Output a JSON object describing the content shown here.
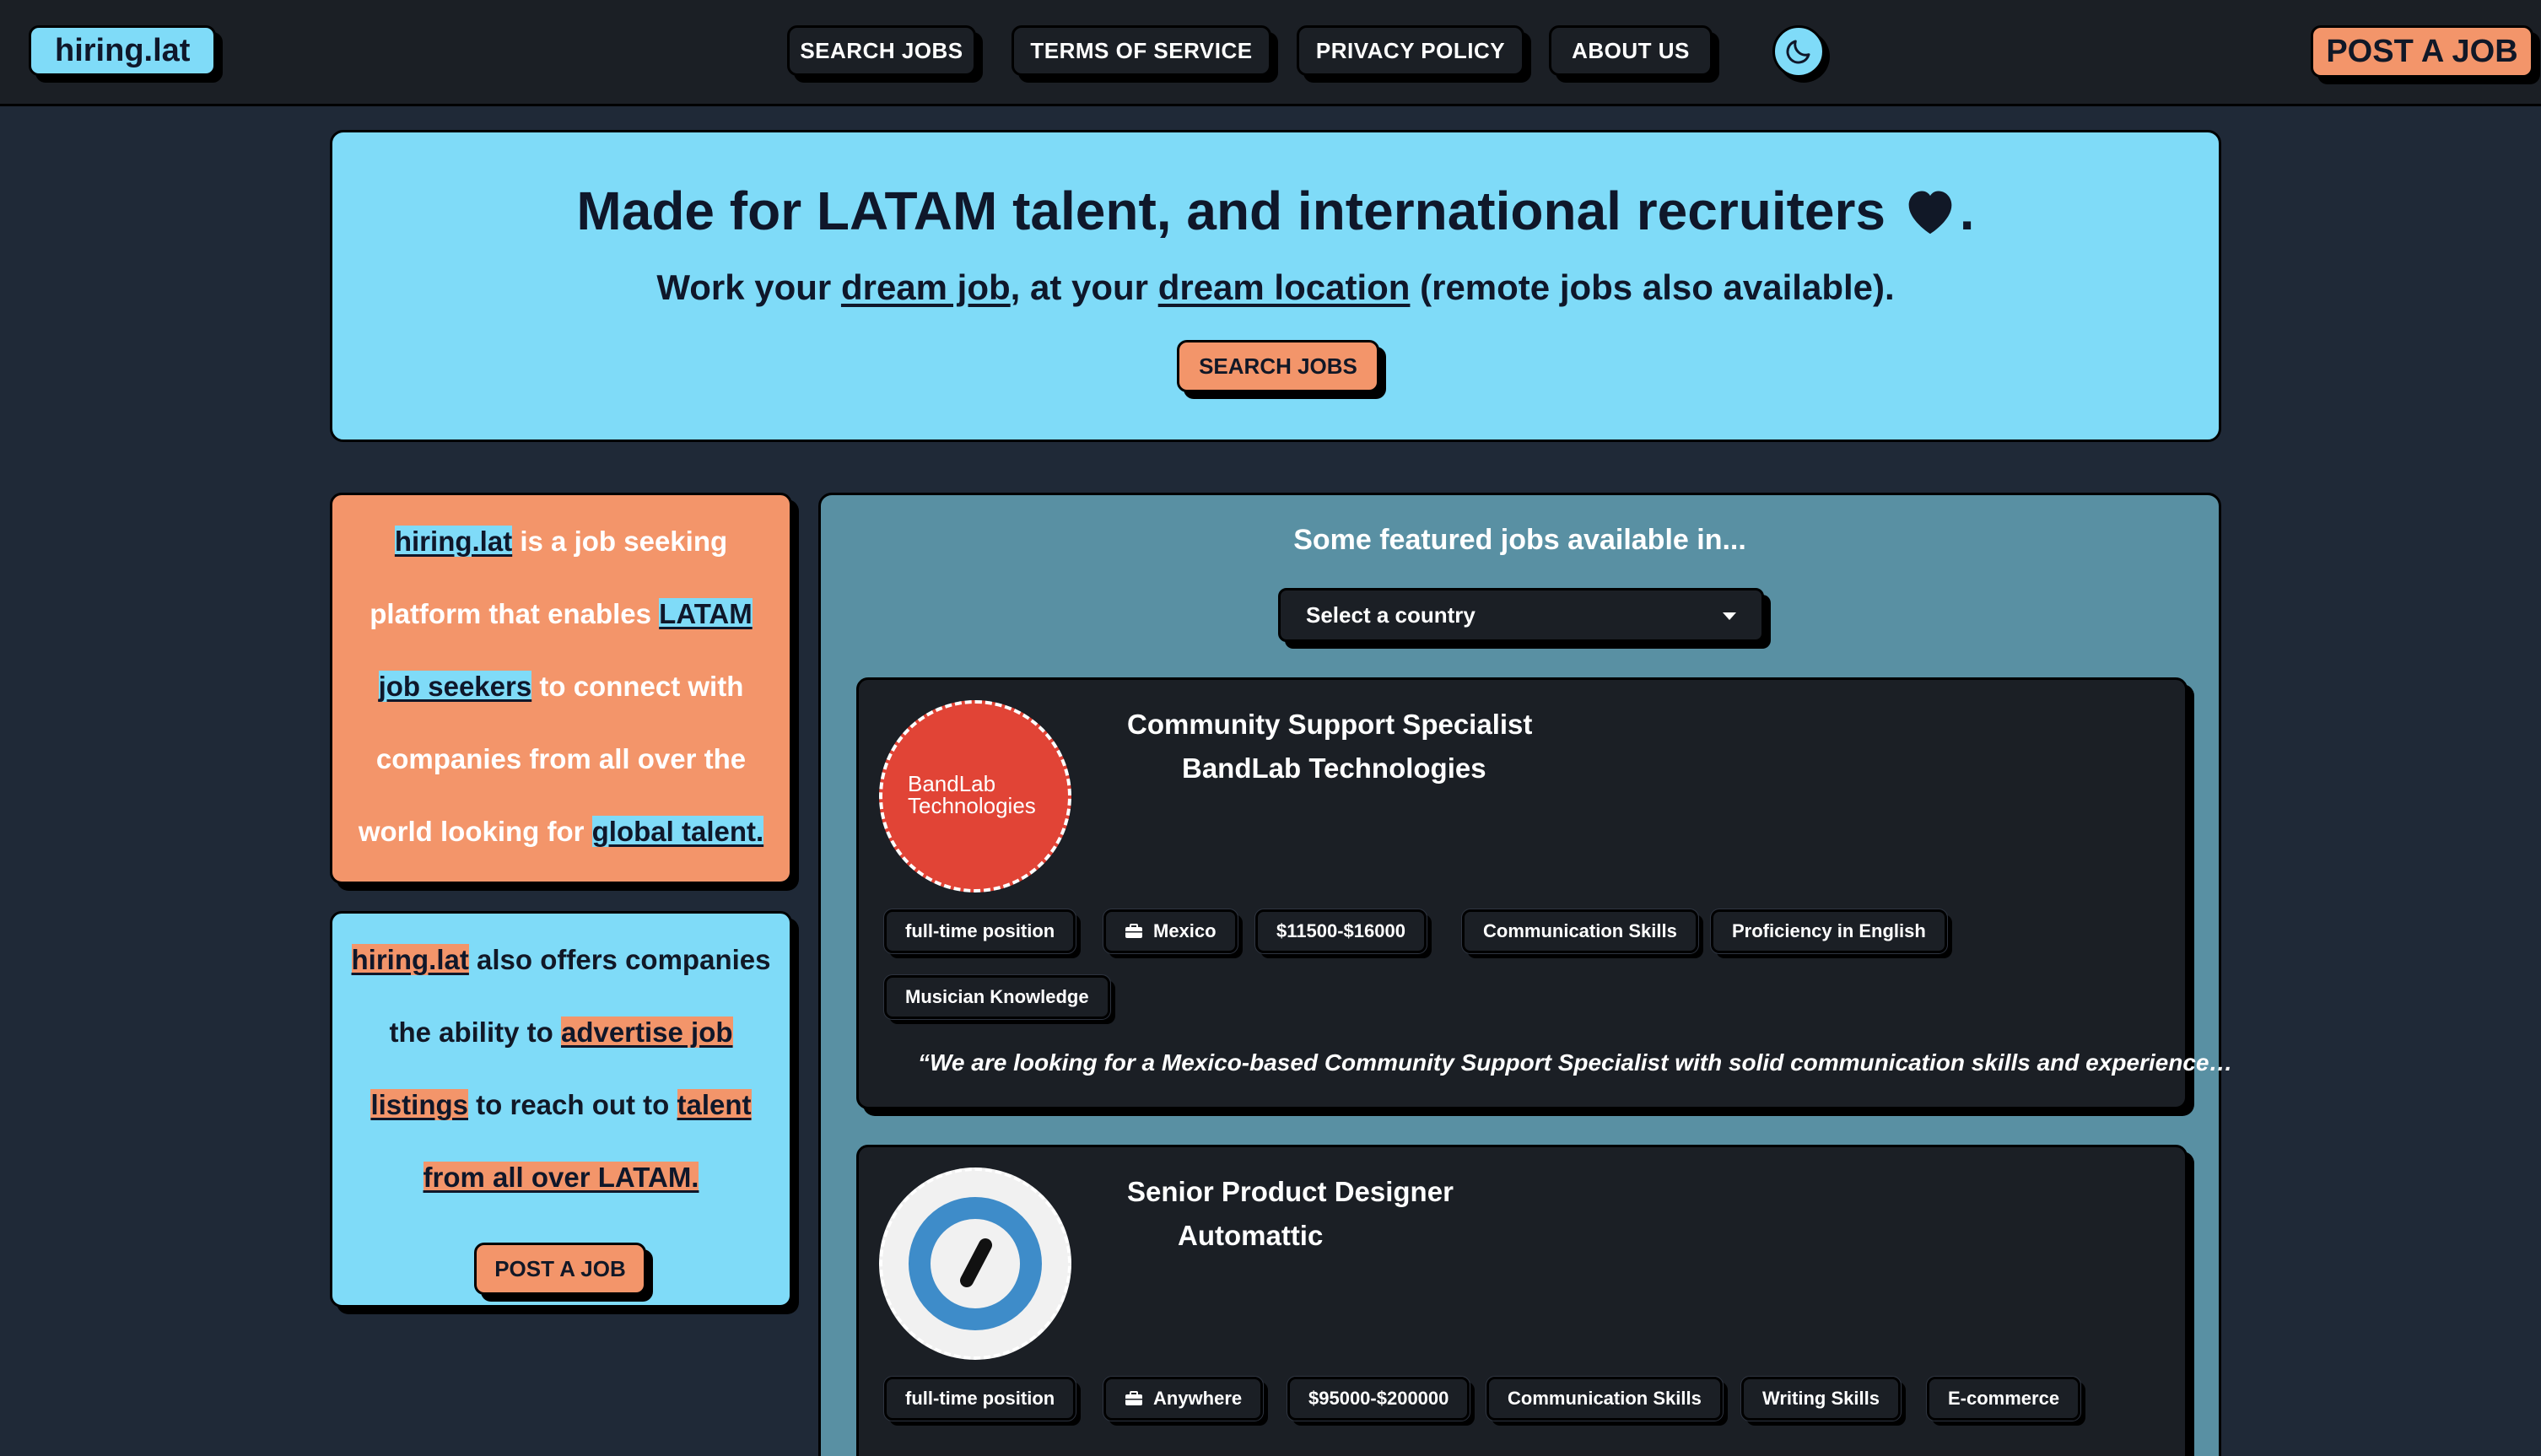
{
  "nav": {
    "logo": "hiring.lat",
    "links": [
      "SEARCH JOBS",
      "TERMS OF SERVICE",
      "PRIVACY POLICY",
      "ABOUT US"
    ],
    "theme_toggle_icon": "moon-icon",
    "post_job": "POST A JOB"
  },
  "hero": {
    "title": "Made for LATAM talent, and international recruiters",
    "title_end": ".",
    "heart_icon": "heart-icon",
    "subtitle_parts": [
      "Work your ",
      "dream job",
      ", at your ",
      "dream location",
      " (remote jobs also available)."
    ],
    "button": "SEARCH JOBS"
  },
  "info_orange": {
    "parts": [
      "hiring.lat",
      " is a job seeking platform that enables ",
      "LATAM job seekers",
      " to connect with companies from all over the world looking for ",
      "global talent."
    ]
  },
  "info_blue": {
    "parts": [
      "hiring.lat",
      " also offers companies the ability to ",
      "advertise job listings",
      " to reach out to ",
      "talent from all over LATAM."
    ],
    "button": "POST A JOB"
  },
  "featured": {
    "heading": "Some featured jobs available in...",
    "select_placeholder": "Select a country",
    "jobs": [
      {
        "title": "Community Support Specialist",
        "company": "BandLab Technologies",
        "logo_text_line1": "BandLab",
        "logo_text_line2": "Technologies",
        "tags": [
          "full-time position",
          "Mexico",
          "$11500-$16000",
          "Communication Skills",
          "Proficiency in English",
          "Musician Knowledge"
        ],
        "description": "“We are looking for a Mexico-based Community Support Specialist with solid communication skills and experience…"
      },
      {
        "title": "Senior Product Designer",
        "company": "Automattic",
        "tags": [
          "full-time position",
          "Anywhere",
          "$95000-$200000",
          "Communication Skills",
          "Writing Skills",
          "E-commerce"
        ]
      }
    ]
  },
  "colors": {
    "accent_blue": "#7fdbf8",
    "accent_orange": "#f3956a",
    "panel_teal": "#5990a3",
    "dark": "#1b1f25"
  }
}
